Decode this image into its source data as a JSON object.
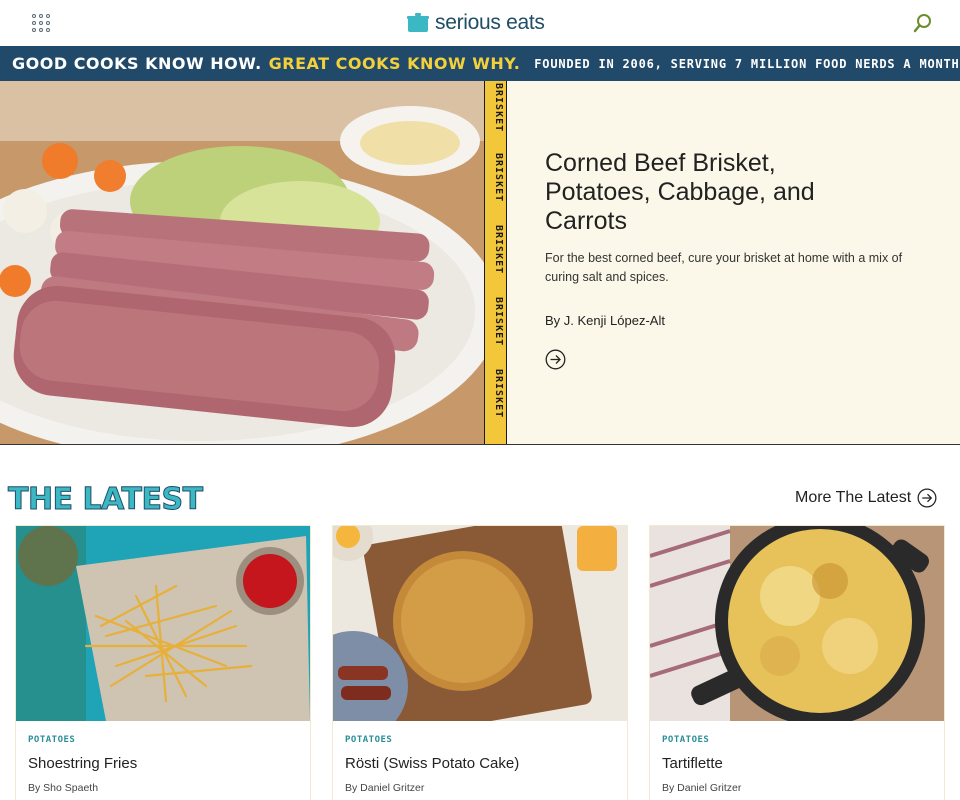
{
  "header": {
    "logo_text": "serious eats",
    "menu_icon": "grid-menu-icon",
    "search_icon": "search-icon"
  },
  "banner": {
    "part1": "GOOD COOKS KNOW HOW.",
    "part2": "GREAT COOKS KNOW WHY.",
    "part3": "FOUNDED IN 2006, SERVING 7 MILLION FOOD NERDS A MONTH"
  },
  "hero": {
    "tag": "BRISKET",
    "title": "Corned Beef Brisket, Potatoes, Cabbage, and Carrots",
    "description": "For the best corned beef, cure your brisket at home with a mix of curing salt and spices.",
    "author": "By J. Kenji López-Alt",
    "arrow_icon": "arrow-right-circle-icon"
  },
  "latest": {
    "heading": "THE LATEST",
    "more_label": "More The Latest",
    "cards": [
      {
        "category": "POTATOES",
        "title": "Shoestring Fries",
        "byline": "By Sho Spaeth"
      },
      {
        "category": "POTATOES",
        "title": "Rösti (Swiss Potato Cake)",
        "byline": "By Daniel Gritzer"
      },
      {
        "category": "POTATOES",
        "title": "Tartiflette",
        "byline": "By Daniel Gritzer"
      }
    ]
  },
  "colors": {
    "banner_bg": "#20496a",
    "banner_accent": "#f4d13a",
    "brand_teal": "#3bb8c4",
    "hero_bg": "#fcf8e9",
    "tag_yellow": "#f2c73a"
  }
}
